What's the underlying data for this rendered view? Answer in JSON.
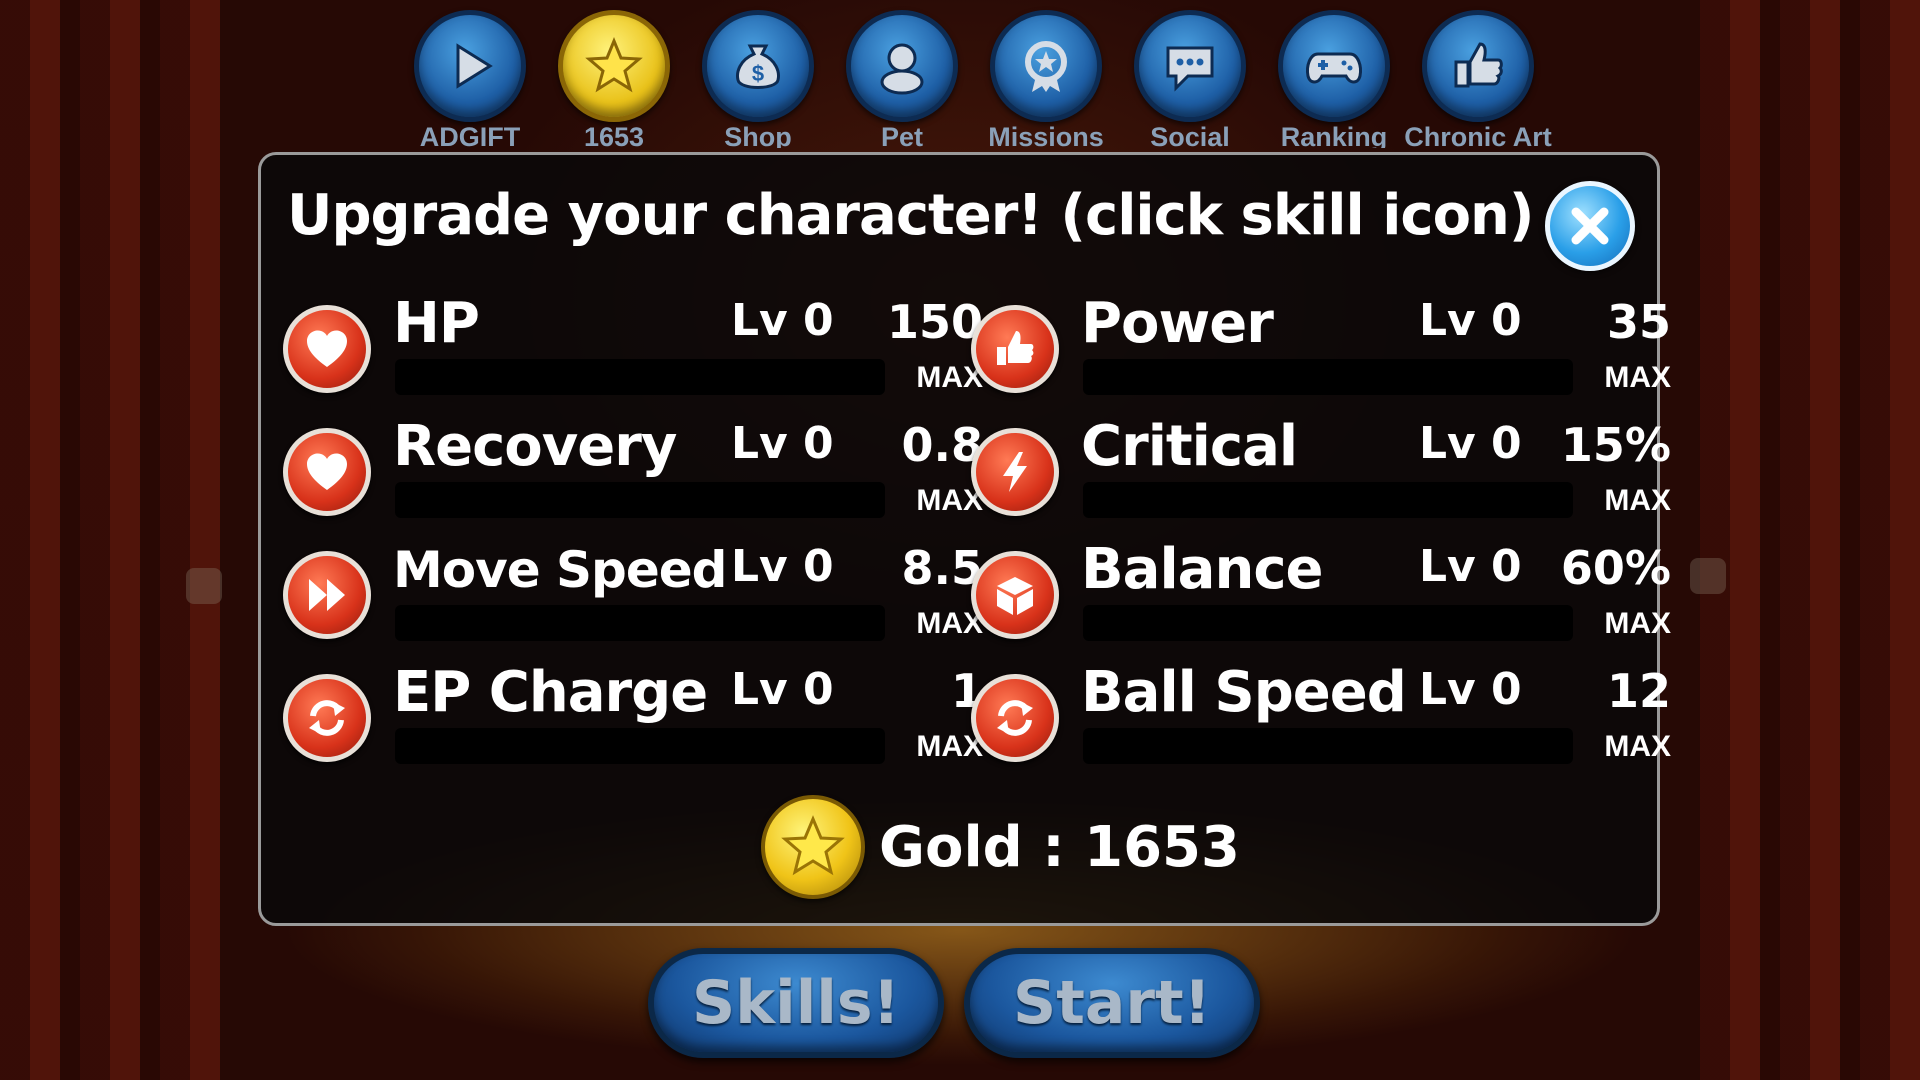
{
  "nav": [
    {
      "label": "ADGIFT",
      "icon": "play-icon"
    },
    {
      "label": "1653",
      "icon": "star-icon"
    },
    {
      "label": "Shop",
      "icon": "money-bag-icon"
    },
    {
      "label": "Pet",
      "icon": "pet-icon"
    },
    {
      "label": "Missions",
      "icon": "medal-icon"
    },
    {
      "label": "Social",
      "icon": "chat-icon"
    },
    {
      "label": "Ranking",
      "icon": "gamepad-icon"
    },
    {
      "label": "Chronic Art",
      "icon": "thumbs-up-icon"
    }
  ],
  "dialog": {
    "title": "Upgrade your character! (click skill icon)",
    "close_icon": "close-icon",
    "skills": [
      {
        "name": "HP",
        "level": "Lv 0",
        "value": "150",
        "max": "MAX",
        "icon": "heart-icon"
      },
      {
        "name": "Power",
        "level": "Lv 0",
        "value": "35",
        "max": "MAX",
        "icon": "thumbs-up-icon"
      },
      {
        "name": "Recovery",
        "level": "Lv 0",
        "value": "0.8",
        "max": "MAX",
        "icon": "heart-icon"
      },
      {
        "name": "Critical",
        "level": "Lv 0",
        "value": "15%",
        "max": "MAX",
        "icon": "lightning-icon"
      },
      {
        "name": "Move Speed",
        "level": "Lv 0",
        "value": "8.5",
        "max": "MAX",
        "icon": "fast-forward-icon"
      },
      {
        "name": "Balance",
        "level": "Lv 0",
        "value": "60%",
        "max": "MAX",
        "icon": "cube-icon"
      },
      {
        "name": "EP Charge",
        "level": "Lv 0",
        "value": "1",
        "max": "MAX",
        "icon": "refresh-icon"
      },
      {
        "name": "Ball Speed",
        "level": "Lv 0",
        "value": "12",
        "max": "MAX",
        "icon": "refresh-icon"
      }
    ],
    "gold_label": "Gold : 1653"
  },
  "buttons": {
    "skills_label": "Skills!",
    "start_label": "Start!"
  },
  "colors": {
    "accent_blue": "#1e5fa6",
    "skill_red": "#d8321a",
    "gold": "#f0c418"
  }
}
